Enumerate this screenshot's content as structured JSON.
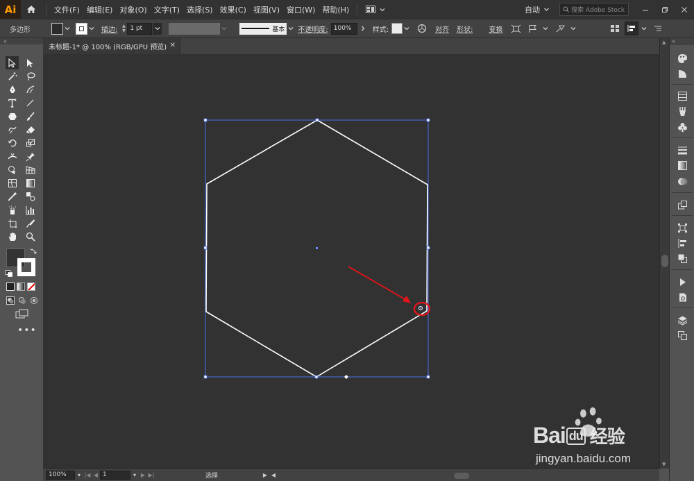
{
  "app": {
    "logo": "Ai",
    "menus": [
      "文件(F)",
      "编辑(E)",
      "对象(O)",
      "文字(T)",
      "选择(S)",
      "效果(C)",
      "视图(V)",
      "窗口(W)",
      "帮助(H)"
    ],
    "workspace": "自动",
    "stock_search_placeholder": "搜索 Adobe Stock"
  },
  "control_bar": {
    "shape_type": "多边形",
    "stroke_label": "描边:",
    "stroke_weight": "1 pt",
    "stroke_profile": "基本",
    "opacity_label": "不透明度:",
    "opacity_value": "100%",
    "style_label": "样式:",
    "align_label": "对齐",
    "shape_label": "形状:",
    "transform_label": "变换"
  },
  "document": {
    "tab_title": "未标题-1* @ 100% (RGB/GPU 预览)",
    "close_glyph": "✕"
  },
  "status_bar": {
    "zoom": "100%",
    "artboard": "1",
    "tool_status": "选择"
  },
  "artwork": {
    "shape": "hexagon",
    "stroke_color": "#ffffff",
    "selection_color": "#4c6fe8",
    "annotation_color": "#e8141a"
  },
  "watermark": {
    "brand": "Bai",
    "brand_du": "du",
    "brand_cn": "经验",
    "url": "jingyan.baidu.com"
  },
  "colors": {
    "app_bg": "#535353",
    "menubar_bg": "#323232",
    "canvas_bg": "#323232",
    "accent_orange": "#ff9a00"
  }
}
